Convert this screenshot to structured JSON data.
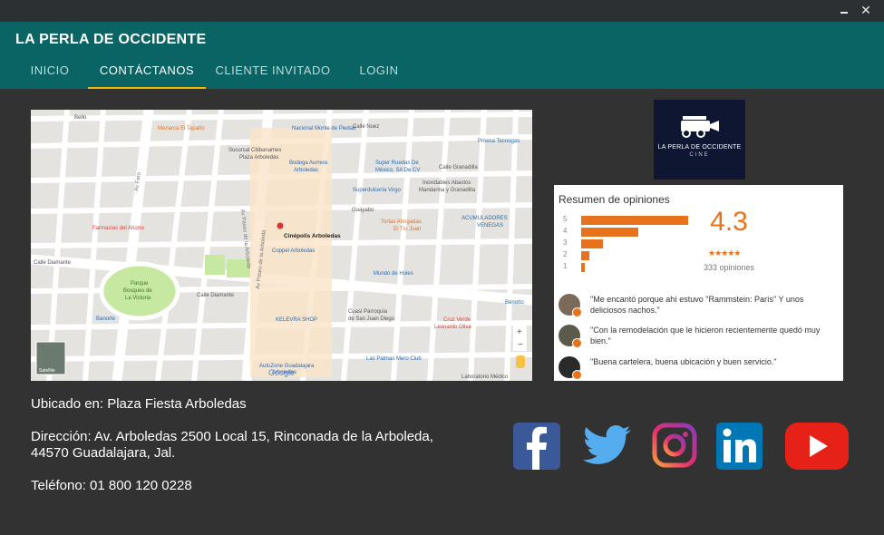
{
  "window": {
    "minimize_label": "–",
    "close_label": "✕"
  },
  "app": {
    "title": "LA PERLA DE OCCIDENTE"
  },
  "tabs": [
    {
      "label": "INICIO"
    },
    {
      "label": "CONTÁCTANOS"
    },
    {
      "label": "CLIENTE INVITADO"
    },
    {
      "label": "LOGIN"
    }
  ],
  "active_tab": "CONTÁCTANOS",
  "map": {
    "main_pin_label": "Cinépolis Arboledas",
    "labels": [
      "Bello",
      "Monarca El Tapatío",
      "Nacional Monte de Piedad",
      "Calle Nuez",
      "Proesa Tecnogas",
      "Sucursal Citibanamex Plaza Arboledas",
      "Bodega Aurrera Arboledas",
      "Super Ruedas De México, SA De CV",
      "Calle Granadilla",
      "Superdulcería Virgo",
      "Inoxidables Abastos Mandarina y Granadilla",
      "Farmacias del Ahorro",
      "Tortas Ahogadas El Tío Juan",
      "ACUMULADORES VENEGAS",
      "Calle Diamante",
      "Parque Bosques de La Victoria",
      "Coppel Arboledas",
      "Mundo de Hules",
      "Banorte",
      "KELEVRA SHOP",
      "Cuasi Parroquia de San Juan Diego",
      "Cruz Verde Leonardo Oliva",
      "Las Palmas Mero Club",
      "AutoZone Guadalajara Arboledas",
      "Laboratorio Médico",
      "Benotto",
      "Av Paseo de la Arboleda",
      "Av Faro",
      "Guayabo",
      "Google",
      "Satellite"
    ]
  },
  "logo": {
    "text": "LA PERLA DE OCCIDENTE",
    "subtext": "CINE"
  },
  "reviews": {
    "title": "Resumen de opiniones",
    "rating": "4.3",
    "stars": "★★★★★",
    "count_text": "333 opiniones",
    "distribution": [
      {
        "stars": "5",
        "fraction": 0.8
      },
      {
        "stars": "4",
        "fraction": 0.43
      },
      {
        "stars": "3",
        "fraction": 0.16
      },
      {
        "stars": "2",
        "fraction": 0.06
      },
      {
        "stars": "1",
        "fraction": 0.03
      }
    ],
    "items": [
      {
        "text": "\"Me encantó porque ahí estuvo \"Rammstein: París\" Y unos deliciosos nachos.\""
      },
      {
        "text": "\"Con la remodelación que le hicieron recientemente quedó muy bien.\""
      },
      {
        "text": "\"Buena cartelera, buena ubicación y buen servicio.\""
      }
    ]
  },
  "contact": {
    "location": "Ubicado en: Plaza Fiesta Arboledas",
    "address_line1": "Dirección: Av. Arboledas 2500 Local 15, Rinconada de la Arboleda,",
    "address_line2": "44570 Guadalajara, Jal.",
    "phone": "Teléfono: 01 800 120 0228"
  },
  "social": [
    {
      "icon": "facebook-icon",
      "color": "#3b5998"
    },
    {
      "icon": "twitter-icon",
      "color": "#55acee"
    },
    {
      "icon": "instagram-icon",
      "color": "#c13584"
    },
    {
      "icon": "linkedin-icon",
      "color": "#0077b5"
    },
    {
      "icon": "youtube-icon",
      "color": "#e62117"
    }
  ],
  "colors": {
    "appbar": "#0a6464",
    "background": "#323232",
    "tab_indicator": "#f4b400",
    "rating_accent": "#e8711c"
  }
}
